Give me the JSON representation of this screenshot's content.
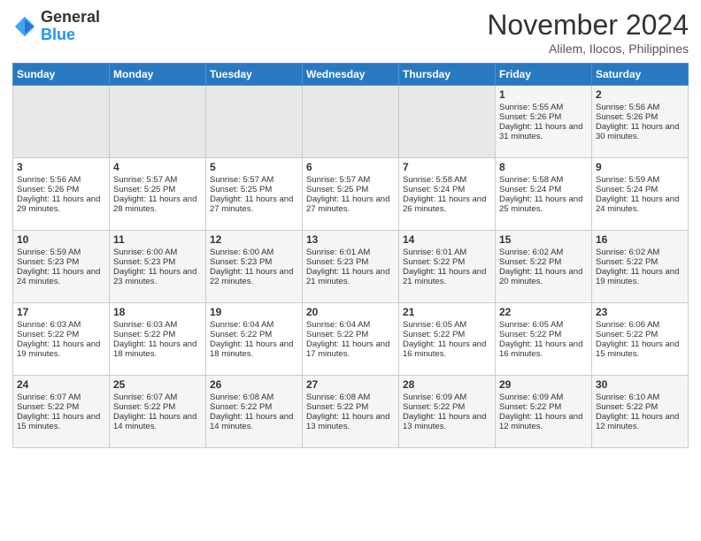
{
  "header": {
    "logo_general": "General",
    "logo_blue": "Blue",
    "month_year": "November 2024",
    "location": "Alilem, Ilocos, Philippines"
  },
  "days_of_week": [
    "Sunday",
    "Monday",
    "Tuesday",
    "Wednesday",
    "Thursday",
    "Friday",
    "Saturday"
  ],
  "weeks": [
    [
      {
        "day": "",
        "empty": true
      },
      {
        "day": "",
        "empty": true
      },
      {
        "day": "",
        "empty": true
      },
      {
        "day": "",
        "empty": true
      },
      {
        "day": "",
        "empty": true
      },
      {
        "day": "1",
        "sunrise": "Sunrise: 5:55 AM",
        "sunset": "Sunset: 5:26 PM",
        "daylight": "Daylight: 11 hours and 31 minutes."
      },
      {
        "day": "2",
        "sunrise": "Sunrise: 5:56 AM",
        "sunset": "Sunset: 5:26 PM",
        "daylight": "Daylight: 11 hours and 30 minutes."
      }
    ],
    [
      {
        "day": "3",
        "sunrise": "Sunrise: 5:56 AM",
        "sunset": "Sunset: 5:26 PM",
        "daylight": "Daylight: 11 hours and 29 minutes."
      },
      {
        "day": "4",
        "sunrise": "Sunrise: 5:57 AM",
        "sunset": "Sunset: 5:25 PM",
        "daylight": "Daylight: 11 hours and 28 minutes."
      },
      {
        "day": "5",
        "sunrise": "Sunrise: 5:57 AM",
        "sunset": "Sunset: 5:25 PM",
        "daylight": "Daylight: 11 hours and 27 minutes."
      },
      {
        "day": "6",
        "sunrise": "Sunrise: 5:57 AM",
        "sunset": "Sunset: 5:25 PM",
        "daylight": "Daylight: 11 hours and 27 minutes."
      },
      {
        "day": "7",
        "sunrise": "Sunrise: 5:58 AM",
        "sunset": "Sunset: 5:24 PM",
        "daylight": "Daylight: 11 hours and 26 minutes."
      },
      {
        "day": "8",
        "sunrise": "Sunrise: 5:58 AM",
        "sunset": "Sunset: 5:24 PM",
        "daylight": "Daylight: 11 hours and 25 minutes."
      },
      {
        "day": "9",
        "sunrise": "Sunrise: 5:59 AM",
        "sunset": "Sunset: 5:24 PM",
        "daylight": "Daylight: 11 hours and 24 minutes."
      }
    ],
    [
      {
        "day": "10",
        "sunrise": "Sunrise: 5:59 AM",
        "sunset": "Sunset: 5:23 PM",
        "daylight": "Daylight: 11 hours and 24 minutes."
      },
      {
        "day": "11",
        "sunrise": "Sunrise: 6:00 AM",
        "sunset": "Sunset: 5:23 PM",
        "daylight": "Daylight: 11 hours and 23 minutes."
      },
      {
        "day": "12",
        "sunrise": "Sunrise: 6:00 AM",
        "sunset": "Sunset: 5:23 PM",
        "daylight": "Daylight: 11 hours and 22 minutes."
      },
      {
        "day": "13",
        "sunrise": "Sunrise: 6:01 AM",
        "sunset": "Sunset: 5:23 PM",
        "daylight": "Daylight: 11 hours and 21 minutes."
      },
      {
        "day": "14",
        "sunrise": "Sunrise: 6:01 AM",
        "sunset": "Sunset: 5:22 PM",
        "daylight": "Daylight: 11 hours and 21 minutes."
      },
      {
        "day": "15",
        "sunrise": "Sunrise: 6:02 AM",
        "sunset": "Sunset: 5:22 PM",
        "daylight": "Daylight: 11 hours and 20 minutes."
      },
      {
        "day": "16",
        "sunrise": "Sunrise: 6:02 AM",
        "sunset": "Sunset: 5:22 PM",
        "daylight": "Daylight: 11 hours and 19 minutes."
      }
    ],
    [
      {
        "day": "17",
        "sunrise": "Sunrise: 6:03 AM",
        "sunset": "Sunset: 5:22 PM",
        "daylight": "Daylight: 11 hours and 19 minutes."
      },
      {
        "day": "18",
        "sunrise": "Sunrise: 6:03 AM",
        "sunset": "Sunset: 5:22 PM",
        "daylight": "Daylight: 11 hours and 18 minutes."
      },
      {
        "day": "19",
        "sunrise": "Sunrise: 6:04 AM",
        "sunset": "Sunset: 5:22 PM",
        "daylight": "Daylight: 11 hours and 18 minutes."
      },
      {
        "day": "20",
        "sunrise": "Sunrise: 6:04 AM",
        "sunset": "Sunset: 5:22 PM",
        "daylight": "Daylight: 11 hours and 17 minutes."
      },
      {
        "day": "21",
        "sunrise": "Sunrise: 6:05 AM",
        "sunset": "Sunset: 5:22 PM",
        "daylight": "Daylight: 11 hours and 16 minutes."
      },
      {
        "day": "22",
        "sunrise": "Sunrise: 6:05 AM",
        "sunset": "Sunset: 5:22 PM",
        "daylight": "Daylight: 11 hours and 16 minutes."
      },
      {
        "day": "23",
        "sunrise": "Sunrise: 6:06 AM",
        "sunset": "Sunset: 5:22 PM",
        "daylight": "Daylight: 11 hours and 15 minutes."
      }
    ],
    [
      {
        "day": "24",
        "sunrise": "Sunrise: 6:07 AM",
        "sunset": "Sunset: 5:22 PM",
        "daylight": "Daylight: 11 hours and 15 minutes."
      },
      {
        "day": "25",
        "sunrise": "Sunrise: 6:07 AM",
        "sunset": "Sunset: 5:22 PM",
        "daylight": "Daylight: 11 hours and 14 minutes."
      },
      {
        "day": "26",
        "sunrise": "Sunrise: 6:08 AM",
        "sunset": "Sunset: 5:22 PM",
        "daylight": "Daylight: 11 hours and 14 minutes."
      },
      {
        "day": "27",
        "sunrise": "Sunrise: 6:08 AM",
        "sunset": "Sunset: 5:22 PM",
        "daylight": "Daylight: 11 hours and 13 minutes."
      },
      {
        "day": "28",
        "sunrise": "Sunrise: 6:09 AM",
        "sunset": "Sunset: 5:22 PM",
        "daylight": "Daylight: 11 hours and 13 minutes."
      },
      {
        "day": "29",
        "sunrise": "Sunrise: 6:09 AM",
        "sunset": "Sunset: 5:22 PM",
        "daylight": "Daylight: 11 hours and 12 minutes."
      },
      {
        "day": "30",
        "sunrise": "Sunrise: 6:10 AM",
        "sunset": "Sunset: 5:22 PM",
        "daylight": "Daylight: 11 hours and 12 minutes."
      }
    ]
  ]
}
